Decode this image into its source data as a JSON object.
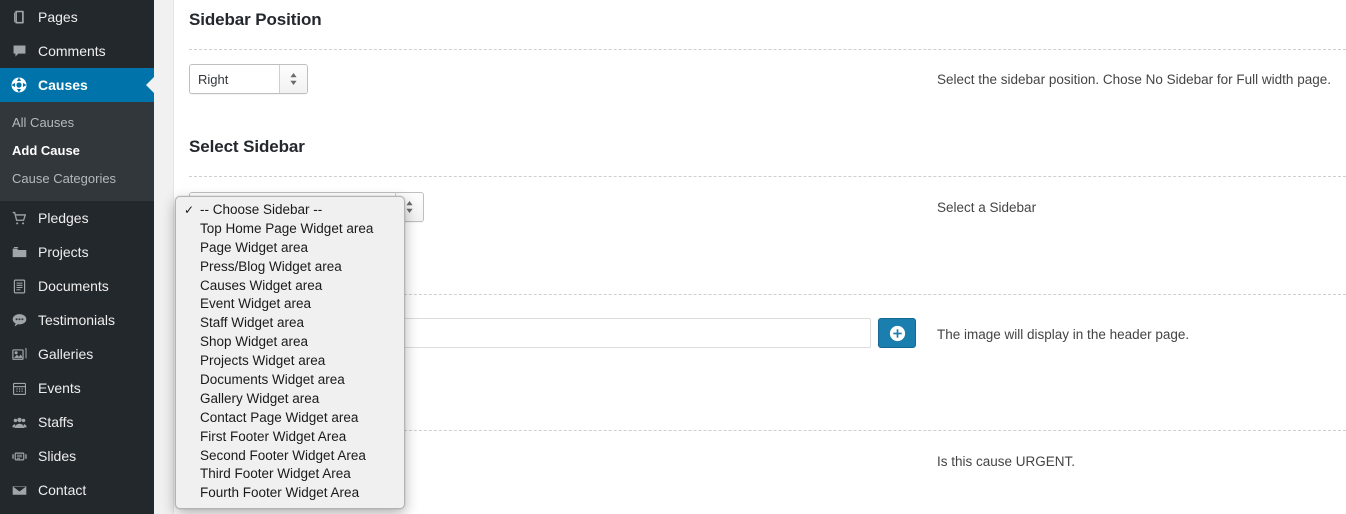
{
  "colors": {
    "sidebar_bg": "#23282d",
    "submenu_bg": "#32373c",
    "accent_blue": "#0073aa",
    "button_blue": "#1a7eae",
    "content_bg": "#ffffff",
    "gutter_bg": "#f1f1f1",
    "dropdown_bg": "#f0f0f0"
  },
  "sidebar": {
    "items": [
      {
        "label": "Pages",
        "icon": "pages-icon",
        "active": false
      },
      {
        "label": "Comments",
        "icon": "comments-icon",
        "active": false
      },
      {
        "label": "Causes",
        "icon": "causes-icon",
        "active": true
      },
      {
        "label": "Pledges",
        "icon": "cart-icon",
        "active": false
      },
      {
        "label": "Projects",
        "icon": "folder-icon",
        "active": false
      },
      {
        "label": "Documents",
        "icon": "document-icon",
        "active": false
      },
      {
        "label": "Testimonials",
        "icon": "testimonial-icon",
        "active": false
      },
      {
        "label": "Galleries",
        "icon": "gallery-icon",
        "active": false
      },
      {
        "label": "Events",
        "icon": "calendar-icon",
        "active": false
      },
      {
        "label": "Staffs",
        "icon": "staff-icon",
        "active": false
      },
      {
        "label": "Slides",
        "icon": "slides-icon",
        "active": false
      },
      {
        "label": "Contact",
        "icon": "envelope-icon",
        "active": false
      }
    ],
    "submenu": [
      {
        "label": "All Causes",
        "current": false
      },
      {
        "label": "Add Cause",
        "current": true
      },
      {
        "label": "Cause Categories",
        "current": false
      }
    ]
  },
  "main": {
    "sections": [
      {
        "title": "Sidebar Position",
        "help": "Select the sidebar position. Chose No Sidebar for Full width page."
      },
      {
        "title": "Select Sidebar",
        "help": "Select a Sidebar"
      }
    ],
    "sidebar_position_select": {
      "value": "Right"
    },
    "sidebar_select": {
      "value": "-- Choose Sidebar --"
    },
    "header_image": {
      "value": "",
      "placeholder": "",
      "help": "The image will display in the header page.",
      "add_button_label": "+"
    },
    "urgent": {
      "help": "Is this cause URGENT."
    }
  },
  "dropdown": {
    "selected_index": 0,
    "check_glyph": "✓",
    "options": [
      "-- Choose Sidebar --",
      "Top Home Page Widget area",
      "Page Widget area",
      "Press/Blog Widget area",
      "Causes Widget area",
      "Event Widget area",
      "Staff Widget area",
      "Shop Widget area",
      "Projects Widget area",
      "Documents Widget area",
      "Gallery Widget area",
      "Contact Page Widget area",
      "First Footer Widget Area",
      "Second Footer Widget Area",
      "Third Footer Widget Area",
      "Fourth Footer Widget Area"
    ]
  }
}
